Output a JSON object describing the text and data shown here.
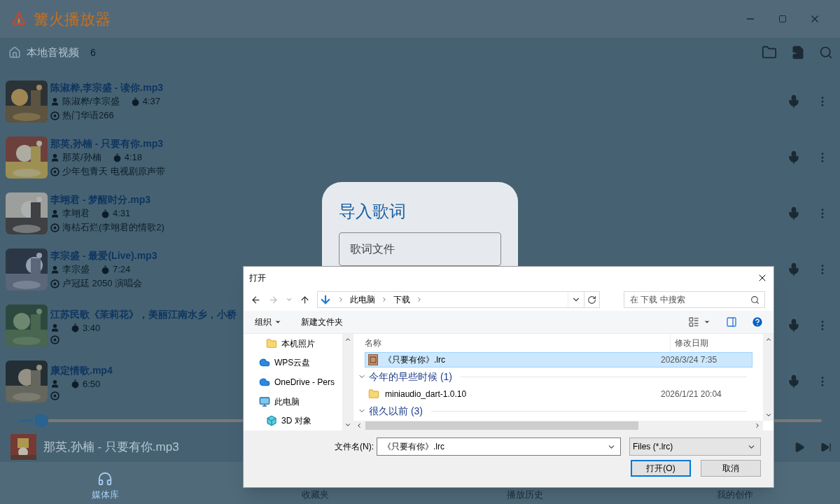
{
  "app": {
    "title": "篝火播放器"
  },
  "library": {
    "title": "本地音视频",
    "count": "6"
  },
  "songs": [
    {
      "title": "陈淑桦,李宗盛 - 读你.mp3",
      "artist": "陈淑桦/李宗盛",
      "duration": "4:37",
      "album": "热门华语266"
    },
    {
      "title": "那英,孙楠 - 只要有你.mp3",
      "artist": "那英/孙楠",
      "duration": "4:18",
      "album": "少年包青天 电视剧原声带"
    },
    {
      "title": "李翊君 - 梦醒时分.mp3",
      "artist": "李翊君",
      "duration": "4:31",
      "album": "海枯石烂(李翊君的情歌2)"
    },
    {
      "title": "李宗盛 - 最爱(Live).mp3",
      "artist": "李宗盛",
      "duration": "7:24",
      "album": "卢冠廷 2050 演唱会"
    },
    {
      "title": "江苏民歌《茉莉花》，美丽江南水乡，小桥",
      "duration": "3:40"
    },
    {
      "title": "康定情歌.mp4",
      "duration": "6:50"
    }
  ],
  "player": {
    "level": 0.02,
    "title": "那英,孙楠 - 只要有你.mp3"
  },
  "nav": [
    {
      "label": "媒体库",
      "selected": true
    },
    {
      "label": "收藏夹",
      "selected": false
    },
    {
      "label": "播放历史",
      "selected": false
    },
    {
      "label": "我的创作",
      "selected": false
    }
  ],
  "lyrics_card": {
    "title": "导入歌词",
    "placeholder": "歌词文件"
  },
  "file_dialog": {
    "title": "打开",
    "path": [
      "此电脑",
      "下载"
    ],
    "search": {
      "placeholder": "在 下载 中搜索"
    },
    "toolbar": {
      "organize": "组织",
      "new_folder": "新建文件夹"
    },
    "nav_tree": [
      {
        "children": [
          {
            "label": "本机照片",
            "kind": "folder"
          }
        ]
      },
      {
        "label": "WPS云盘",
        "kind": "cloud"
      },
      {
        "label": "OneDrive - Pers",
        "kind": "cloud"
      },
      {
        "label": "此电脑",
        "kind": "computer",
        "children": [
          {
            "label": "3D 对象",
            "kind": "cube"
          }
        ]
      }
    ],
    "columns": [
      "名称",
      "修改日期"
    ],
    "items": [
      {
        "kind": "file",
        "name": "《只要有你》.lrc",
        "date": "2026/3/24 7:35",
        "selected": true
      },
      {
        "kind": "group",
        "name": "今年的早些时候 (1)",
        "expanded": true
      },
      {
        "kind": "folder",
        "name": "miniaudio_dart-1.0.10",
        "date": "2026/1/21 20:04",
        "selected": false
      },
      {
        "kind": "group",
        "name": "很久以前 (3)",
        "expanded": true
      }
    ],
    "filename_label": "文件名(N):",
    "filename": "《只要有你》.lrc",
    "filter": "Files (*.lrc)",
    "buttons": [
      {
        "label": "打开(O)",
        "default": true
      },
      {
        "label": "取消",
        "default": false
      }
    ]
  }
}
